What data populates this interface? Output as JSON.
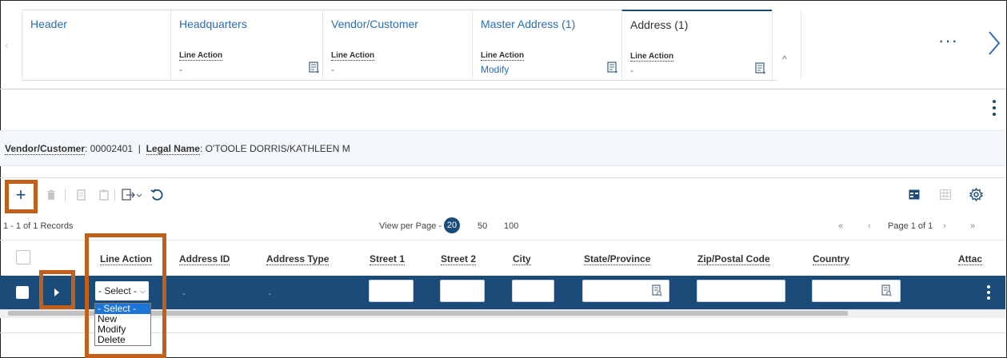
{
  "tabs": [
    {
      "title": "Header",
      "line_action_label": "",
      "line_action_value": ""
    },
    {
      "title": "Headquarters",
      "line_action_label": "Line Action",
      "line_action_value": "-"
    },
    {
      "title": "Vendor/Customer",
      "line_action_label": "Line Action",
      "line_action_value": "-"
    },
    {
      "title": "Master Address (1)",
      "line_action_label": "Line Action",
      "line_action_value": "Modify"
    },
    {
      "title": "Address (1)",
      "line_action_label": "Line Action",
      "line_action_value": "-"
    }
  ],
  "tab_overflow": {
    "more_label": "···"
  },
  "info": {
    "vendor_label": "Vendor/Customer",
    "vendor_value": ": 00002401",
    "divider": "|",
    "legal_label": "Legal Name",
    "legal_value": ": O'TOOLE DORRIS/KATHLEEN M"
  },
  "pager": {
    "records": "1 - 1 of 1 Records",
    "view_per_page": "View per Page -",
    "sizes": [
      "20",
      "50",
      "100"
    ],
    "page_label": "Page 1 of 1",
    "first": "«",
    "prev": "‹",
    "next": "›",
    "last": "»"
  },
  "columns": [
    "Line Action",
    "Address ID",
    "Address Type",
    "Street 1",
    "Street 2",
    "City",
    "State/Province",
    "Zip/Postal Code",
    "Country",
    "Attac"
  ],
  "row": {
    "line_action_select": "- Select -",
    "address_id": "-",
    "address_type": "-"
  },
  "dropdown_options": [
    "- Select -",
    "New",
    "Modify",
    "Delete"
  ],
  "colors": {
    "accent": "#1b4b78",
    "highlight": "#c0601a",
    "link": "#2c6db0"
  }
}
